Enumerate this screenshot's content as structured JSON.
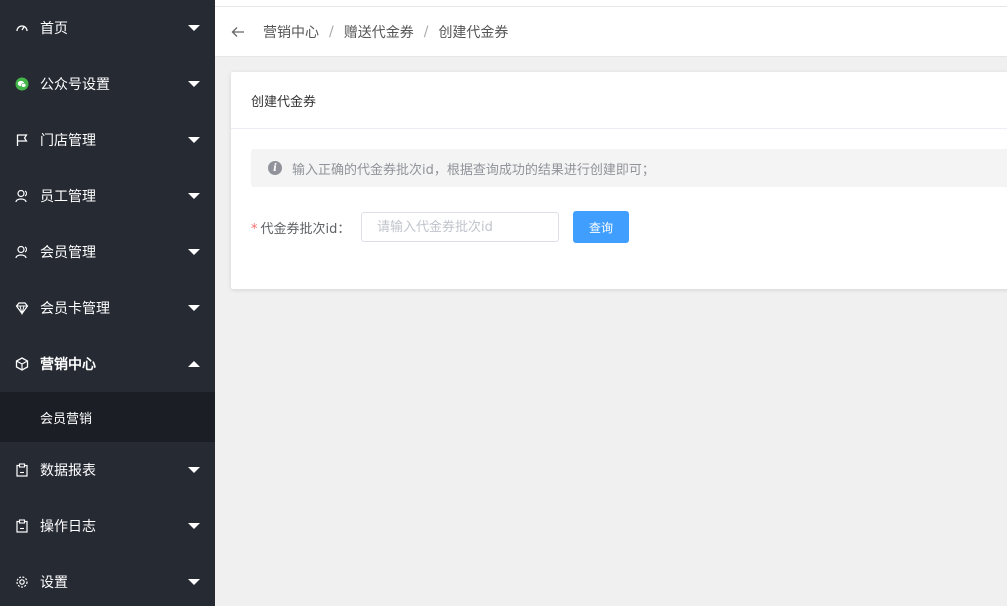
{
  "sidebar": {
    "items": [
      {
        "label": "首页",
        "icon": "dashboard-icon"
      },
      {
        "label": "公众号设置",
        "icon": "wechat-icon"
      },
      {
        "label": "门店管理",
        "icon": "flag-icon"
      },
      {
        "label": "员工管理",
        "icon": "user-icon"
      },
      {
        "label": "会员管理",
        "icon": "user-icon"
      },
      {
        "label": "会员卡管理",
        "icon": "diamond-icon"
      },
      {
        "label": "营销中心",
        "icon": "box-icon",
        "expanded": true
      },
      {
        "label": "数据报表",
        "icon": "clipboard-icon"
      },
      {
        "label": "操作日志",
        "icon": "clipboard-icon"
      },
      {
        "label": "设置",
        "icon": "gear-icon"
      }
    ],
    "submenu": [
      {
        "label": "会员营销"
      }
    ]
  },
  "breadcrumb": {
    "items": [
      "营销中心",
      "赠送代金券",
      "创建代金券"
    ],
    "separator": "/"
  },
  "card": {
    "title": "创建代金券",
    "alert": "输入正确的代金券批次id，根据查询成功的结果进行创建即可；",
    "alert_icon": "i",
    "form": {
      "required_mark": "*",
      "label": "代金券批次id：",
      "placeholder": "请输入代金券批次id",
      "value": "",
      "submit_label": "查询"
    }
  },
  "colors": {
    "sidebar_bg": "#252a33",
    "submenu_bg": "#1b1f25",
    "primary": "#409eff",
    "wechat_green": "#44b549"
  }
}
